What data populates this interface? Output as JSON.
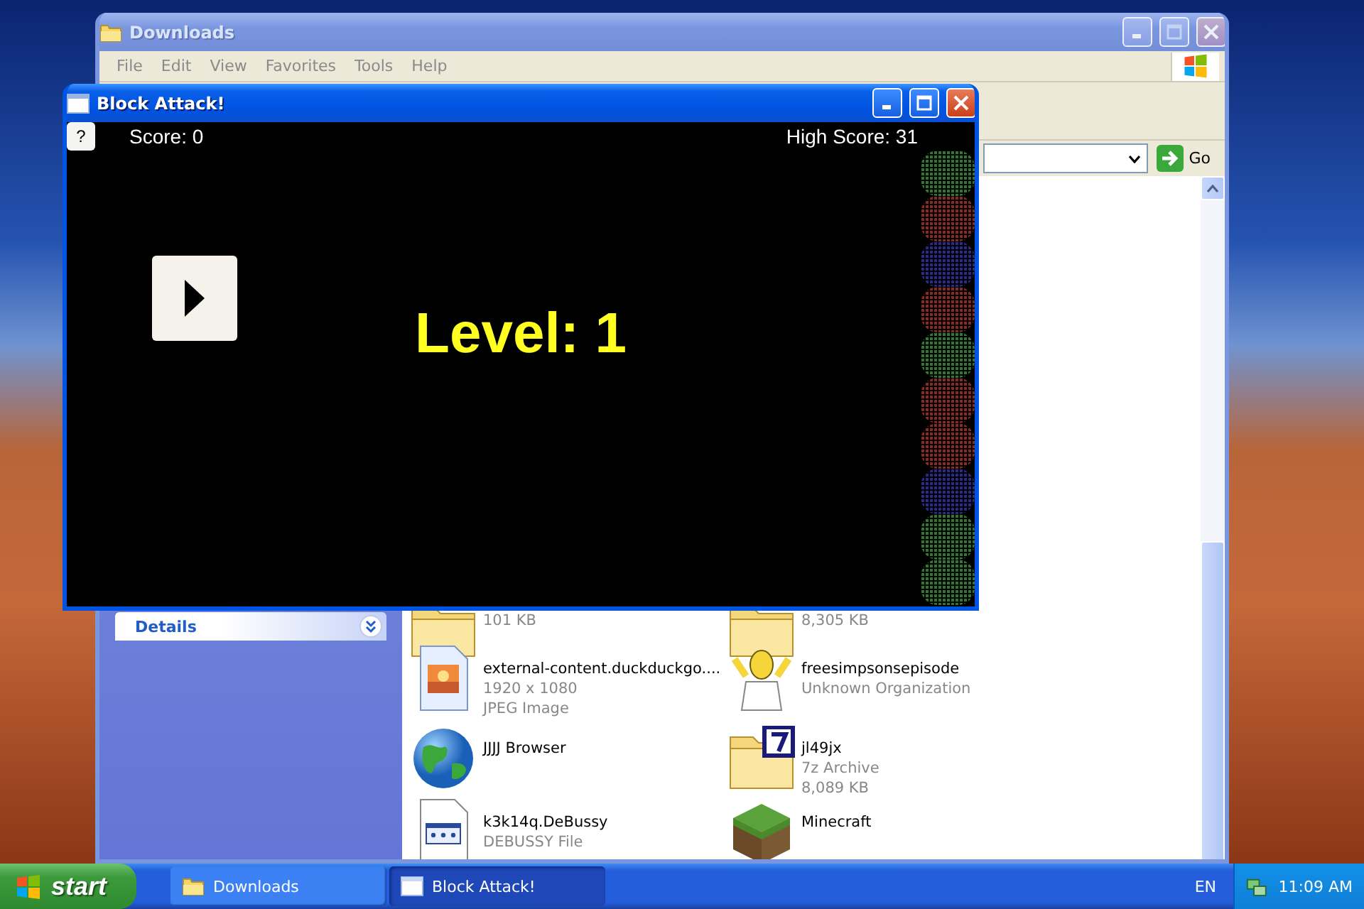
{
  "explorer": {
    "title": "Downloads",
    "active": false,
    "menu": [
      "File",
      "Edit",
      "View",
      "Favorites",
      "Tools",
      "Help"
    ],
    "go_button": "Go",
    "details_panel": {
      "title": "Details",
      "expanded": false
    },
    "files": [
      {
        "kind": "archive",
        "details": [
          "101 KB"
        ]
      },
      {
        "kind": "archive",
        "details": [
          "8,305 KB"
        ]
      },
      {
        "kind": "image",
        "name": "external-content.duckduckgo....",
        "details": [
          "1920 x 1080",
          "JPEG Image"
        ]
      },
      {
        "kind": "cartoon",
        "name": "freesimpsonsepisode",
        "details": [
          "Unknown Organization"
        ]
      },
      {
        "kind": "globe",
        "name": "JJJJ Browser"
      },
      {
        "kind": "sevenzip",
        "name": "jl49jx",
        "details": [
          "7z Archive",
          "8,089 KB"
        ]
      },
      {
        "kind": "document",
        "name": "k3k14q.DeBussy",
        "details": [
          "DEBUSSY File"
        ]
      },
      {
        "kind": "grass",
        "name": "Minecraft"
      }
    ]
  },
  "game": {
    "title": "Block Attack!",
    "active": true,
    "help_button": "?",
    "score": "Score: 0",
    "high_score": "High Score: 31",
    "level_text": "Level: 1",
    "blocks": [
      {
        "color": "#2f7a2f"
      },
      {
        "color": "#8a2a22"
      },
      {
        "color": "#2a2a8a"
      },
      {
        "color": "#8a2a22"
      },
      {
        "color": "#2f7a2f"
      },
      {
        "color": "#8a2a22"
      },
      {
        "color": "#8a2a22"
      },
      {
        "color": "#2a2a8a"
      },
      {
        "color": "#2f7a2f"
      },
      {
        "color": "#2f7a2f"
      }
    ]
  },
  "taskbar": {
    "start": "start",
    "tasks": [
      {
        "label": "Downloads",
        "kind": "folder",
        "selected": false
      },
      {
        "label": "Block Attack!",
        "kind": "window",
        "selected": true
      }
    ],
    "language": "EN",
    "clock": "11:09 AM"
  }
}
